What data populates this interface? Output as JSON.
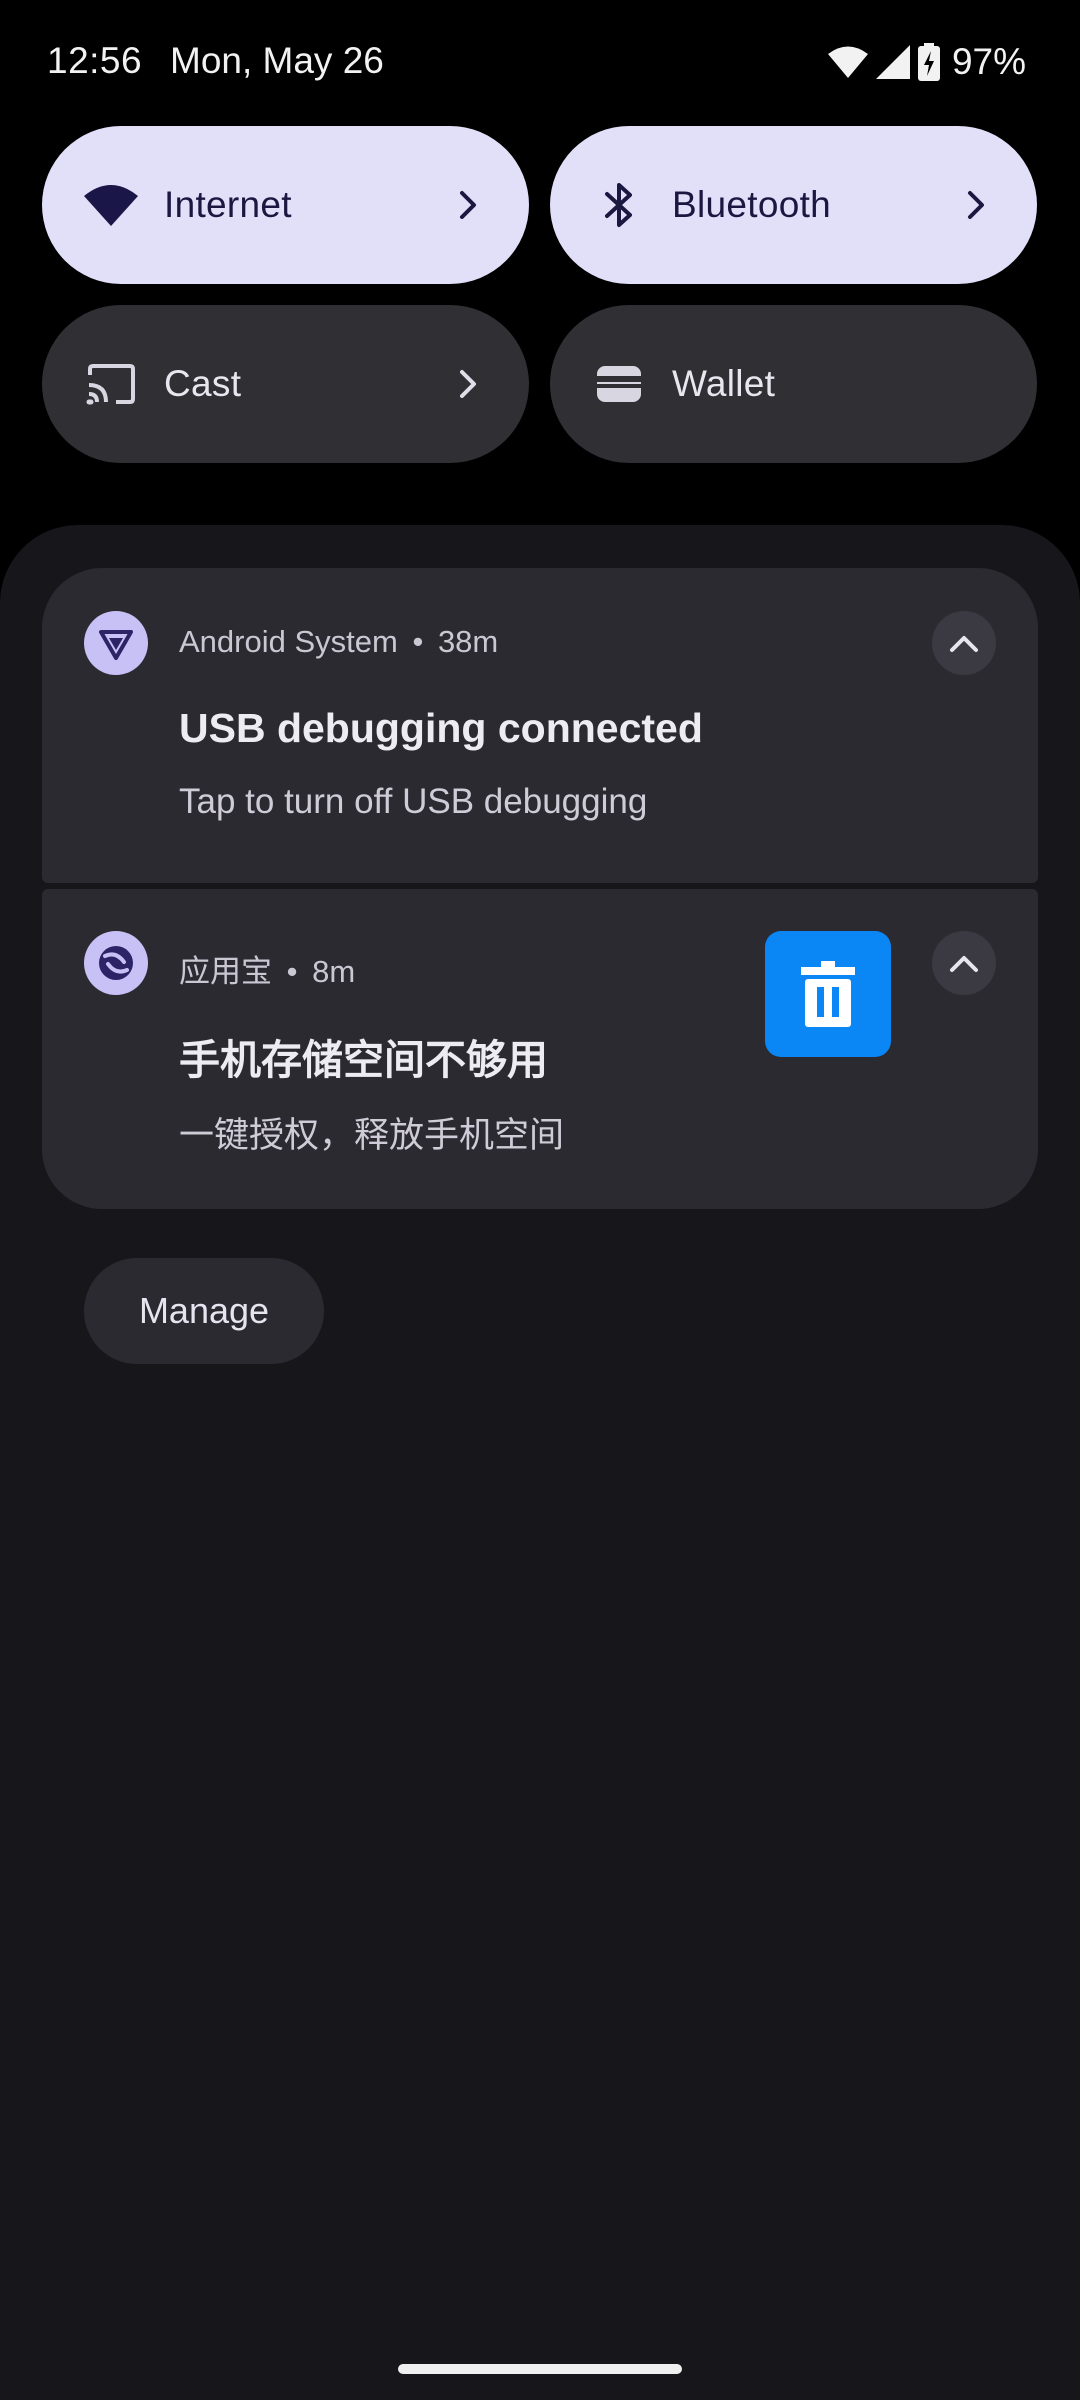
{
  "status_bar": {
    "time": "12:56",
    "date": "Mon, May 26",
    "battery": "97%",
    "icons": [
      "wifi-icon",
      "cell-signal-icon",
      "battery-charging-icon"
    ]
  },
  "quick_tiles": [
    {
      "label": "Internet",
      "icon": "wifi-icon",
      "active": true,
      "has_chevron": true
    },
    {
      "label": "Bluetooth",
      "icon": "bluetooth-icon",
      "active": true,
      "has_chevron": true
    },
    {
      "label": "Cast",
      "icon": "cast-icon",
      "active": false,
      "has_chevron": true
    },
    {
      "label": "Wallet",
      "icon": "wallet-icon",
      "active": false,
      "has_chevron": false
    }
  ],
  "notifications": [
    {
      "app": "Android System",
      "separator": "•",
      "time": "38m",
      "title": "USB debugging connected",
      "body": "Tap to turn off USB debugging",
      "icon": "android-system-icon"
    },
    {
      "app": "应用宝",
      "separator": "•",
      "time": "8m",
      "title": "手机存储空间不够用",
      "body": "一键授权，释放手机空间",
      "icon": "app-store-icon",
      "large_icon": "trash-icon"
    }
  ],
  "manage_label": "Manage",
  "colors": {
    "tile_active": "#e2e0f9",
    "tile_inactive": "#2f2f34",
    "shade_background": "#16161b",
    "notification_background": "#2b2a31",
    "trash_accent": "#0a86f5"
  }
}
